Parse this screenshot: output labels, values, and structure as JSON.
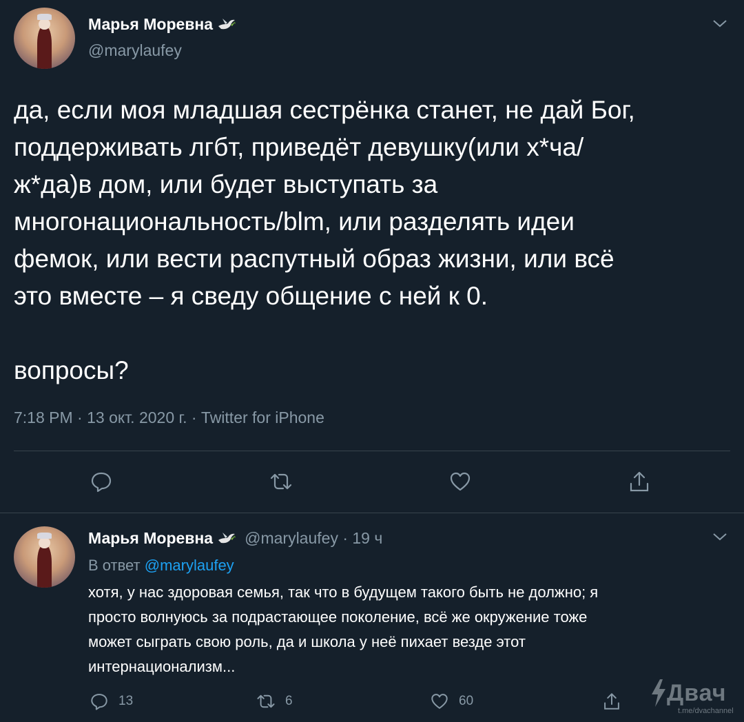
{
  "main_tweet": {
    "display_name": "Марья Моревна",
    "handle": "@marylaufey",
    "text": "да, если моя младшая сестрёнка станет, не дай Бог,\nподдерживать лгбт, приведёт девушку(или х*ча/\nж*да)в дом, или будет выступать за\nмногонациональность/blm, или разделять идеи\nфемок, или вести распутный образ жизни, или всё\nэто вместе – я сведу общение с ней к 0.\n\nвопросы?",
    "meta": "7:18 PM · 13 окт. 2020 г. · Twitter for iPhone",
    "icons": [
      "reply-icon",
      "retweet-icon",
      "like-icon",
      "share-icon"
    ]
  },
  "reply_tweet": {
    "display_name": "Марья Моревна",
    "handle_time": "@marylaufey · 19 ч",
    "reply_prefix": "В ответ ",
    "reply_mention": "@marylaufey",
    "text": "хотя, у нас здоровая семья, так что в будущем такого быть не должно; я\nпросто волнуюсь за подрастающее поколение, всё же окружение тоже\nможет сыграть свою роль, да и школа у неё пихает везде этот\nинтернационализм...",
    "reply_count": "13",
    "retweet_count": "6",
    "like_count": "60"
  },
  "watermark": {
    "brand": "Двач",
    "sub": "t.me/dvachannel"
  },
  "colors": {
    "background": "#15202b",
    "secondary_text": "#8899a6",
    "link": "#1da1f2",
    "divider": "#38444d"
  }
}
